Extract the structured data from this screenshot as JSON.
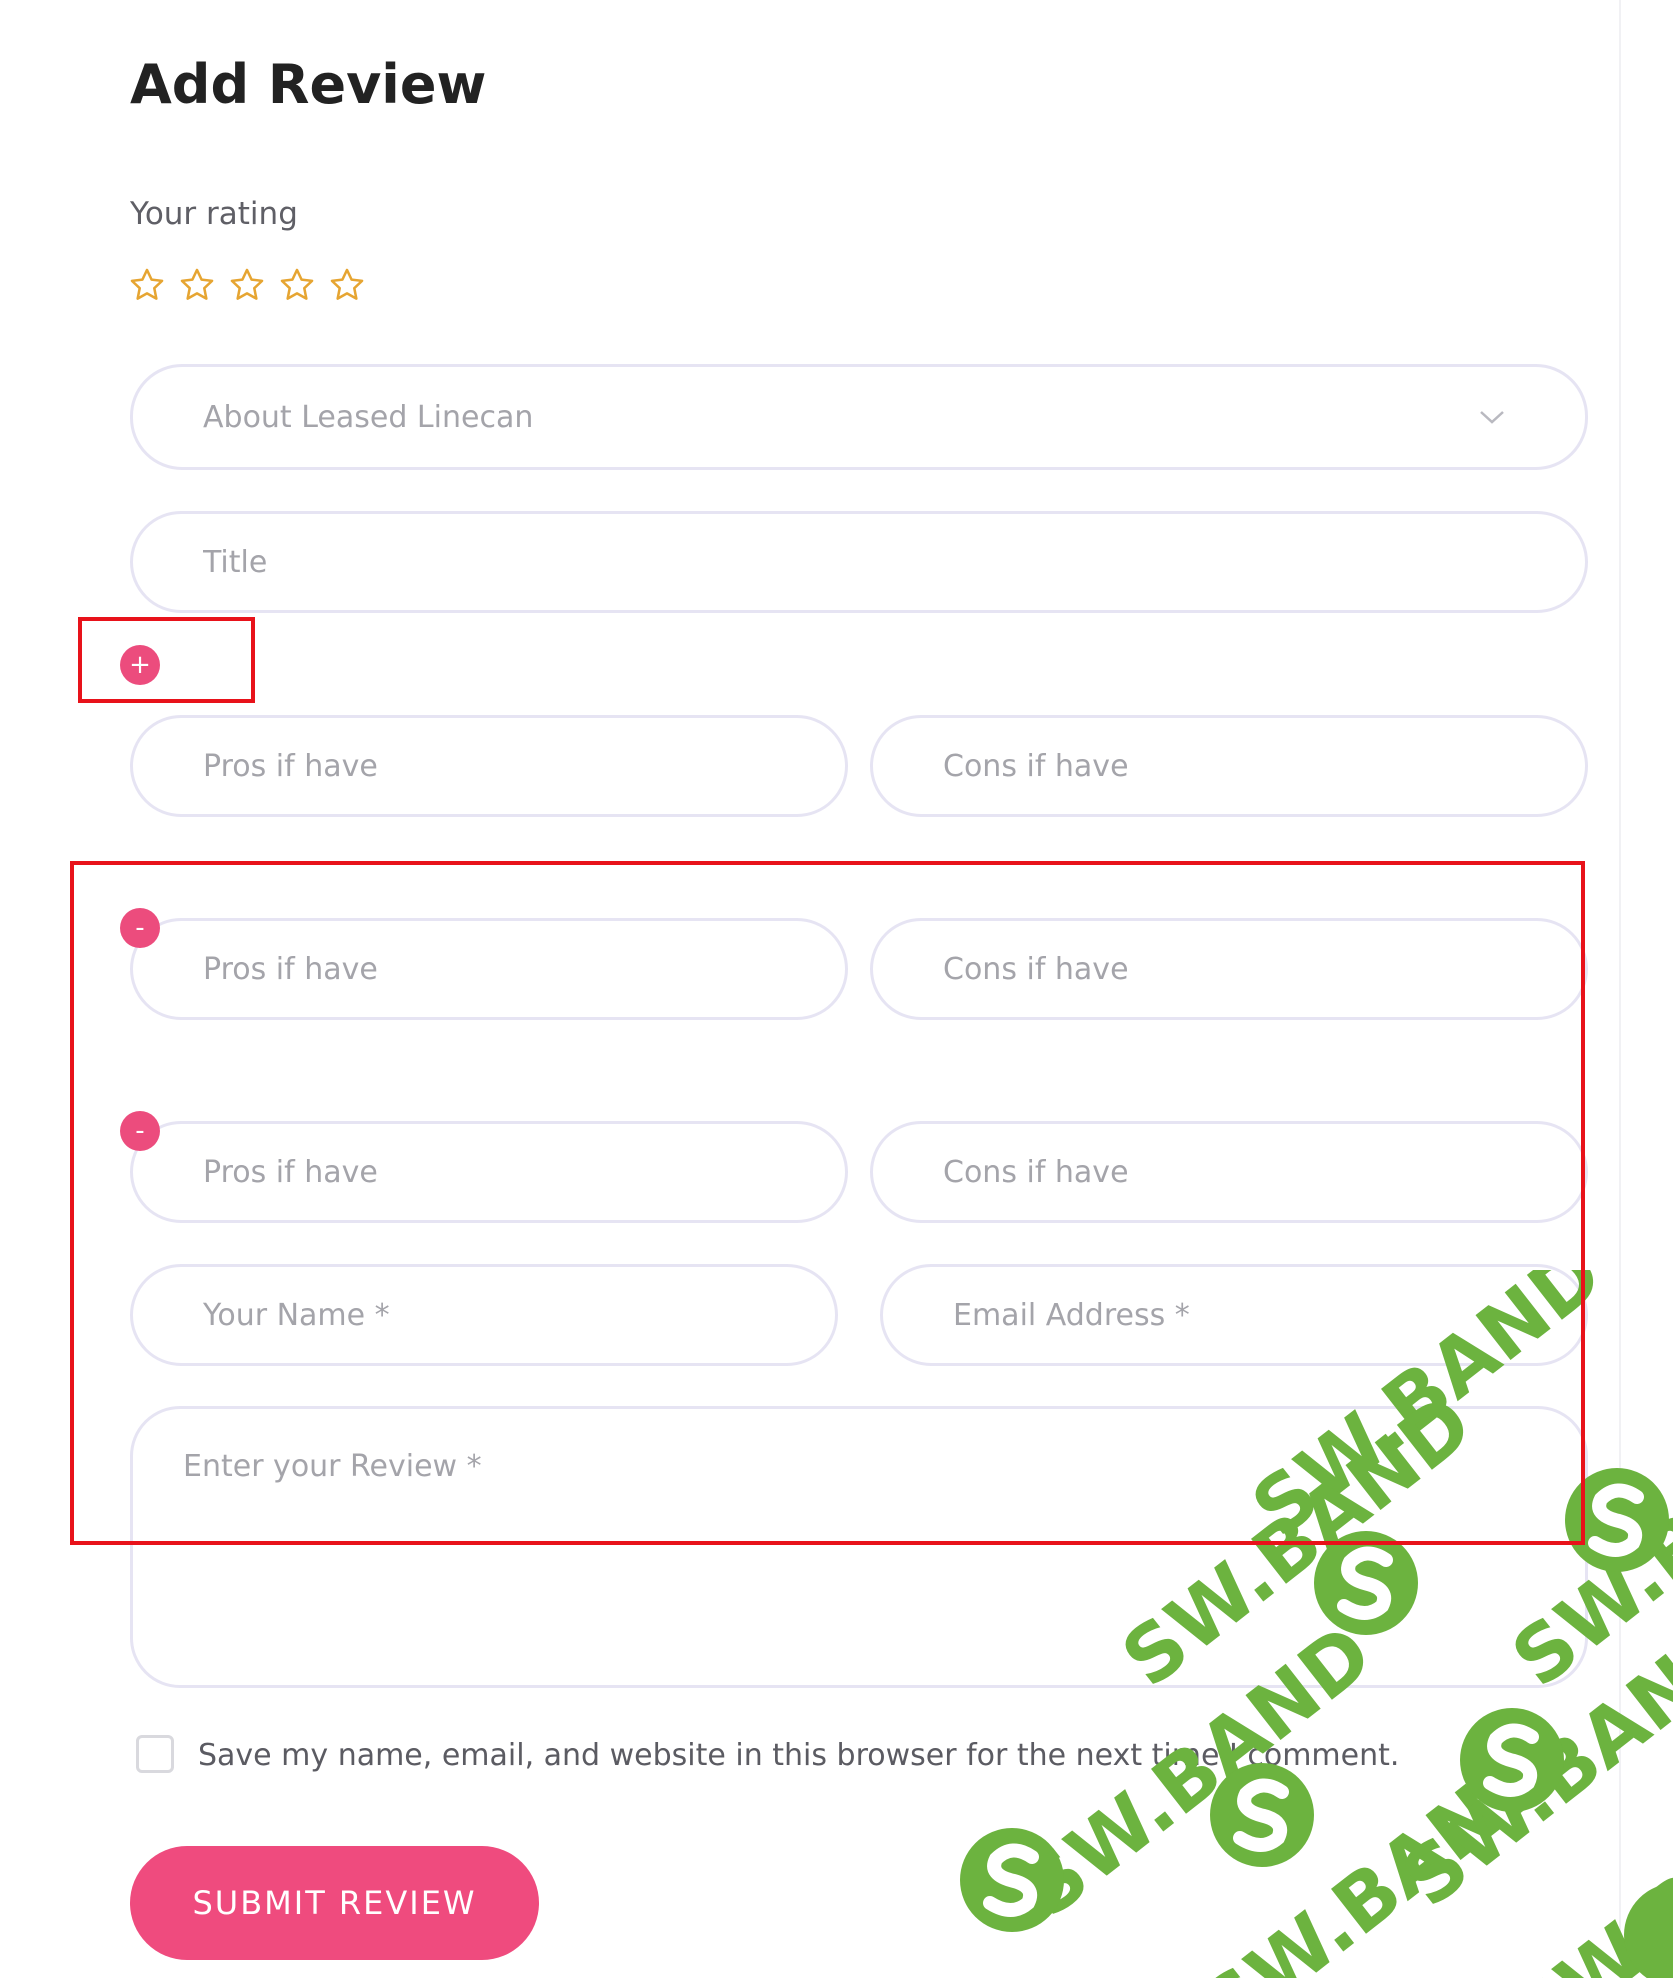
{
  "heading": "Add Review",
  "rating": {
    "label": "Your rating",
    "value": 0,
    "max": 5,
    "star_color": "#e6a532"
  },
  "about_select": {
    "selected": "About Leased Linecan"
  },
  "title_field": {
    "placeholder": "Title"
  },
  "pros_cons": [
    {
      "pros_placeholder": "Pros if have",
      "cons_placeholder": "Cons if have",
      "control": "+"
    },
    {
      "pros_placeholder": "Pros if have",
      "cons_placeholder": "Cons if have",
      "control": "-"
    },
    {
      "pros_placeholder": "Pros if have",
      "cons_placeholder": "Cons if have",
      "control": "-"
    }
  ],
  "name_field": {
    "placeholder": "Your Name *"
  },
  "email_field": {
    "placeholder": "Email Address *"
  },
  "review_field": {
    "placeholder": "Enter your Review *"
  },
  "save_info": {
    "label": "Save my name, email, and website in this browser for the next time I comment.",
    "checked": false
  },
  "submit": {
    "label": "SUBMIT REVIEW"
  },
  "watermark": {
    "text": "SW.BAND"
  },
  "colors": {
    "accent": "#ef4b7e",
    "border": "#e6e4f3",
    "highlight_box": "#e8121a",
    "watermark_green": "#6cb33f"
  }
}
